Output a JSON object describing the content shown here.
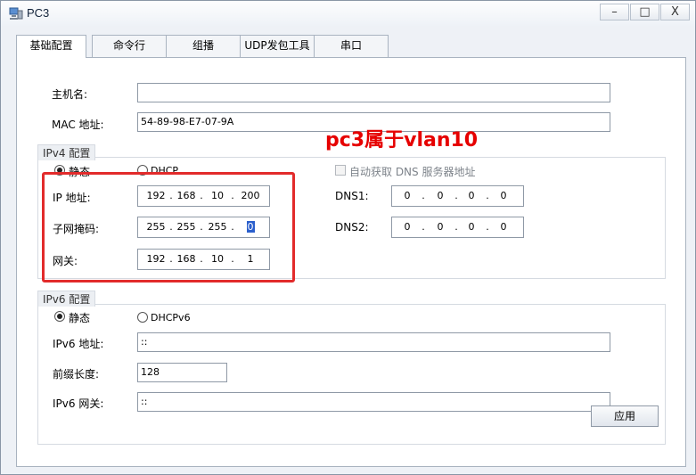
{
  "window": {
    "title": "PC3",
    "icon": "pc-terminal-icon",
    "controls": [
      "–",
      "□",
      "X"
    ]
  },
  "tabs": [
    {
      "label": "基础配置",
      "active": true
    },
    {
      "label": "命令行",
      "active": false
    },
    {
      "label": "组播",
      "active": false
    },
    {
      "label": "UDP发包工具",
      "active": false
    },
    {
      "label": "串口",
      "active": false
    }
  ],
  "basic": {
    "hostname_label": "主机名:",
    "hostname_value": "",
    "mac_label": "MAC 地址:",
    "mac_value": "54-89-98-E7-07-9A"
  },
  "ipv4": {
    "group_title": "IPv4 配置",
    "static_label": "静态",
    "dhcp_label": "DHCP",
    "mode": "static",
    "auto_dns_label": "自动获取 DNS 服务器地址",
    "ip_label": "IP 地址:",
    "ip": [
      "192",
      "168",
      "10",
      "200"
    ],
    "mask_label": "子网掩码:",
    "mask": [
      "255",
      "255",
      "255",
      "0"
    ],
    "gateway_label": "网关:",
    "gateway": [
      "192",
      "168",
      "10",
      "1"
    ],
    "dns1_label": "DNS1:",
    "dns1": [
      "0",
      "0",
      "0",
      "0"
    ],
    "dns2_label": "DNS2:",
    "dns2": [
      "0",
      "0",
      "0",
      "0"
    ]
  },
  "ipv6": {
    "group_title": "IPv6 配置",
    "static_label": "静态",
    "dhcp_label": "DHCPv6",
    "mode": "static",
    "ip_label": "IPv6 地址:",
    "ip_value": "::",
    "prefix_label": "前缀长度:",
    "prefix_value": "128",
    "gateway_label": "IPv6 网关:",
    "gateway_value": "::"
  },
  "annotation": {
    "text": "pc3属于vlan10",
    "color": "#e60000"
  },
  "apply_label": "应用"
}
